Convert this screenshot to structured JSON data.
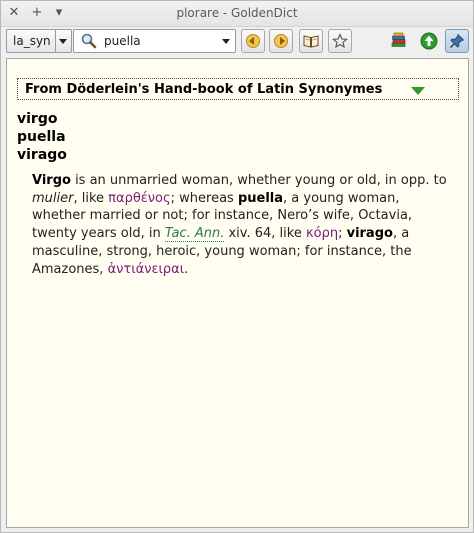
{
  "window": {
    "title": "plorare - GoldenDict",
    "controls": {
      "close": "✕",
      "maximize": "+",
      "menu": "▾"
    }
  },
  "toolbar": {
    "group": "la_syn",
    "search_value": "puella",
    "buttons": [
      "back-icon",
      "forward-icon",
      "open-book-icon",
      "star-icon"
    ],
    "right_icons": [
      "dictionaries-icon",
      "up-arrow-icon",
      "pin-icon"
    ]
  },
  "article": {
    "dictionary_name": "From Döderlein's Hand-book of Latin Synonymes",
    "headwords": [
      "virgo",
      "puella",
      "virago"
    ],
    "body": {
      "w1": "Virgo",
      "t1": " is an unmarried woman, whether young or old, in opp. to ",
      "mulier": "mulier",
      "t2": ", like ",
      "g1": "παρθένος",
      "t3": "; whereas ",
      "w2": "puella",
      "t4": ", a young woman, whether married or not; for instance, Nero’s wife, Octavia, twenty years old, in ",
      "ref": "Tac. Ann.",
      "t5": " xiv. 64, like ",
      "g2": "κόρη",
      "t6": "; ",
      "w3": "virago",
      "t7": ", a masculine, strong, heroic, young woman; for instance, the Amazones, ",
      "g3": "ἀντιάνειραι",
      "t8": "."
    }
  },
  "colors": {
    "greek_text": "#7a1a7a",
    "reference_link": "#2b7a4f",
    "article_background": "#fffef0",
    "collapse_marker": "#2f9a2f"
  }
}
